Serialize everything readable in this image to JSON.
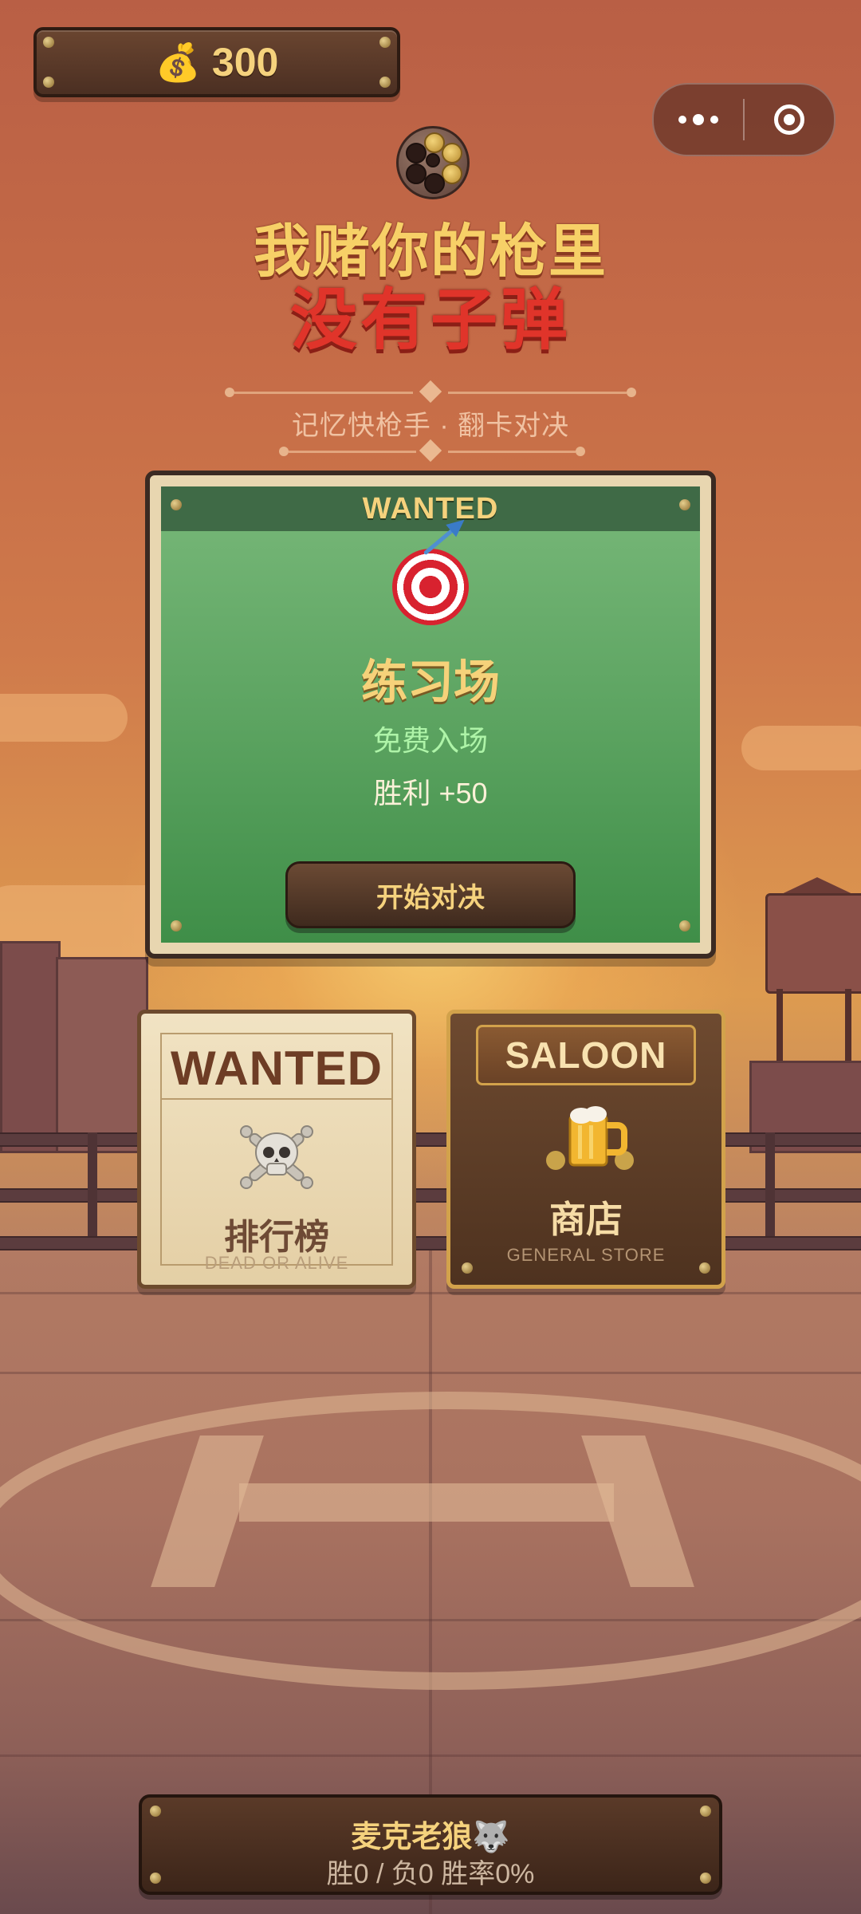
{
  "header": {
    "coin_icon": "money-bag-icon",
    "coins": "300"
  },
  "capsule": {
    "more_icon": "more-dots-icon",
    "close_icon": "target-ring-icon"
  },
  "title": {
    "line1": "我赌你的枪里",
    "line2": "没有子弹",
    "subtitle": "记忆快枪手 · 翻卡对决"
  },
  "practice_card": {
    "banner": "WANTED",
    "icon": "dart-target-icon",
    "title": "练习场",
    "entry": "免费入场",
    "reward": "胜利 +50",
    "button_label": "开始对决"
  },
  "leaderboard_card": {
    "header": "WANTED",
    "icon": "skull-crossbones-icon",
    "label": "排行榜",
    "sublabel": "DEAD OR ALIVE"
  },
  "shop_card": {
    "sign": "SALOON",
    "icon": "beer-mug-icon",
    "label": "商店",
    "sublabel": "GENERAL STORE"
  },
  "player": {
    "name": "麦克老狼🐺",
    "stats": "胜0 / 负0  胜率0%"
  },
  "colors": {
    "gold_text": "#f5d27d",
    "title_red": "#e0342a",
    "practice_green": "#5aa25f",
    "wood_dark": "#3c2519"
  }
}
